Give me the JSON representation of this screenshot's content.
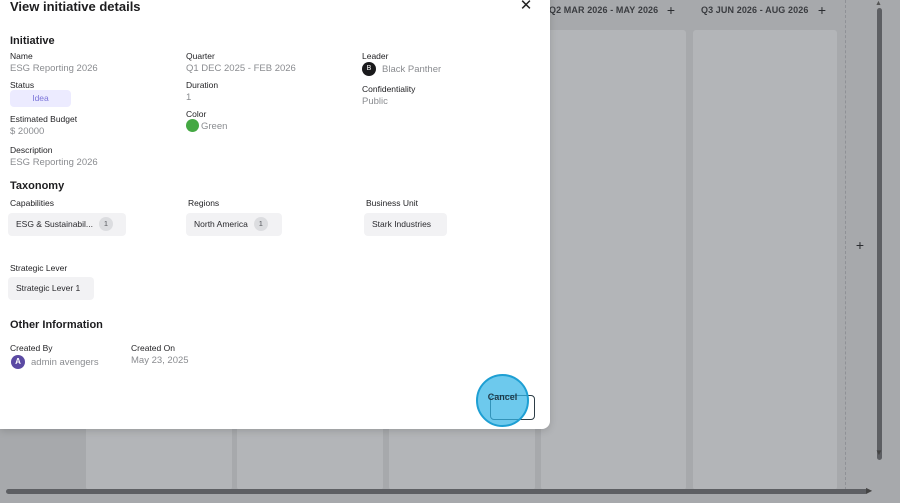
{
  "board": {
    "columns": [
      {
        "header": "Q2 MAR 2026 - MAY 2026",
        "add_icon": "plus-icon"
      },
      {
        "header": "Q3 JUN 2026 - AUG 2026",
        "add_icon": "plus-icon"
      }
    ],
    "side_add_icon": "plus-icon",
    "plus_glyph": "+"
  },
  "modal": {
    "title": "View initiative details",
    "close_glyph": "✕",
    "initiative": {
      "section_title": "Initiative",
      "name_label": "Name",
      "name_value": "ESG Reporting 2026",
      "quarter_label": "Quarter",
      "quarter_value": "Q1 DEC 2025 - FEB 2026",
      "leader_label": "Leader",
      "leader_value": "Black Panther",
      "leader_avatar_initial": "B",
      "status_label": "Status",
      "status_value": "Idea",
      "duration_label": "Duration",
      "duration_value": "1",
      "confidentiality_label": "Confidentiality",
      "confidentiality_value": "Public",
      "budget_label": "Estimated Budget",
      "budget_value": "$ 20000",
      "color_label": "Color",
      "color_value": "Green",
      "color_hex": "#44a843",
      "description_label": "Description",
      "description_value": "ESG Reporting 2026"
    },
    "taxonomy": {
      "section_title": "Taxonomy",
      "capabilities_label": "Capabilities",
      "capabilities_chip": "ESG & Sustainabil...",
      "capabilities_count": "1",
      "regions_label": "Regions",
      "regions_chip": "North America",
      "regions_count": "1",
      "business_unit_label": "Business Unit",
      "business_unit_chip": "Stark Industries",
      "strategic_lever_label": "Strategic Lever",
      "strategic_lever_chip": "Strategic Lever 1"
    },
    "other": {
      "section_title": "Other Information",
      "created_by_label": "Created By",
      "created_by_value": "admin avengers",
      "created_by_avatar_initial": "A",
      "created_on_label": "Created On",
      "created_on_value": "May 23, 2025"
    },
    "cancel_label": "Cancel"
  },
  "scroll": {
    "up": "▲",
    "down": "▼",
    "right": "▶"
  }
}
